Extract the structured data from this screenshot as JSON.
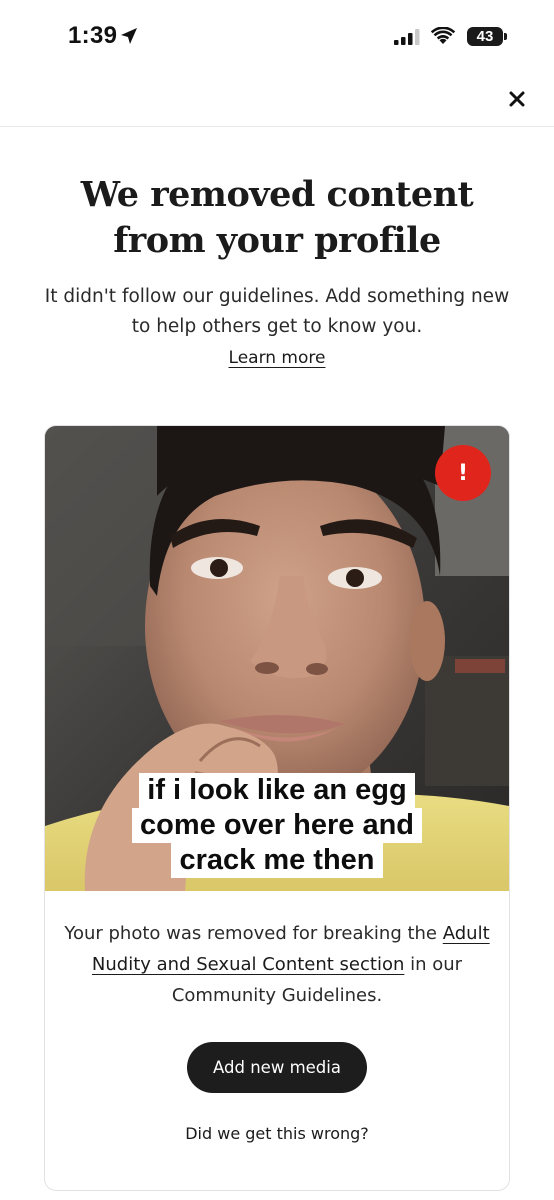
{
  "status_bar": {
    "time": "1:39",
    "battery_level": "43"
  },
  "title": "We removed content from your profile",
  "subtitle": "It didn't follow our guidelines. Add something new to help others get to know you.",
  "learn_more": "Learn more",
  "card": {
    "alert_badge": "!",
    "photo_caption_lines": [
      "if i look like an egg",
      "come over here and",
      "crack me then"
    ],
    "removal_text_before": "Your photo was removed for breaking the",
    "removal_link": "Adult Nudity and Sexual Content section",
    "removal_text_after": "in our Community Guidelines.",
    "add_media_button": "Add new media",
    "wrong_link": "Did we get this wrong?"
  },
  "colors": {
    "alert": "#e0261c",
    "button_bg": "#1d1d1d",
    "photo_shirt": "#e8d87a"
  },
  "icons": [
    "location-arrow-icon",
    "cellular-signal-icon",
    "wifi-icon",
    "battery-icon",
    "close-icon",
    "alert-icon"
  ]
}
